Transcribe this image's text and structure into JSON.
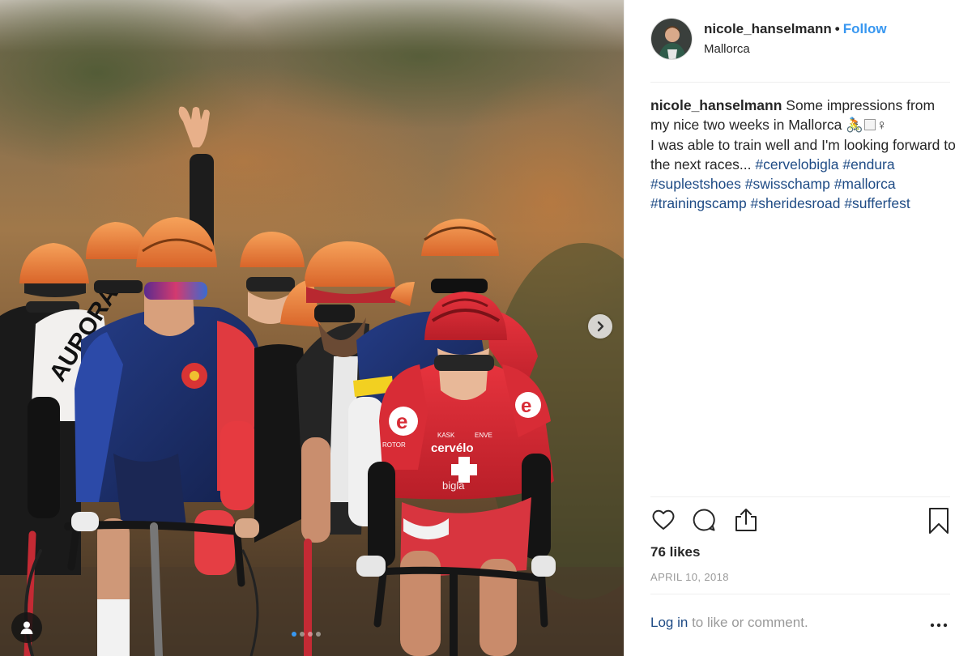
{
  "post": {
    "username": "nicole_hanselmann",
    "bullet": "•",
    "follow_label": "Follow",
    "location": "Mallorca",
    "caption": {
      "username": "nicole_hanselmann",
      "line1": "Some impressions from my nice two weeks in Mallorca 🚴",
      "line1_tail": "♀",
      "line2": "I was able to train well and I'm looking forward to the next races...",
      "hashtags": [
        "#cervelobigla",
        "#endura",
        "#suplestshoes",
        "#swisschamp",
        "#mallorca",
        "#trainingscamp",
        "#sheridesroad",
        "#sufferfest"
      ]
    },
    "likes": "76 likes",
    "date": "APRIL 10, 2018",
    "login_link": "Log in",
    "login_suffix": "to like or comment."
  },
  "photo": {
    "jersey_text": [
      "cervélo",
      "bigla",
      "AURORA",
      "KASK",
      "ROTOR",
      "ENVE"
    ]
  },
  "icons": {
    "like": "heart-icon",
    "comment": "comment-icon",
    "share": "share-icon",
    "save": "bookmark-icon",
    "next": "chevron-right-icon",
    "tags": "user-tag-icon",
    "more": "more-options-icon"
  },
  "colors": {
    "link_blue": "#3897f0",
    "hashtag_blue": "#1e4b85",
    "jersey_red": "#e0303a",
    "jersey_navy": "#1d2f6b",
    "helmet_orange": "#f0883a"
  }
}
